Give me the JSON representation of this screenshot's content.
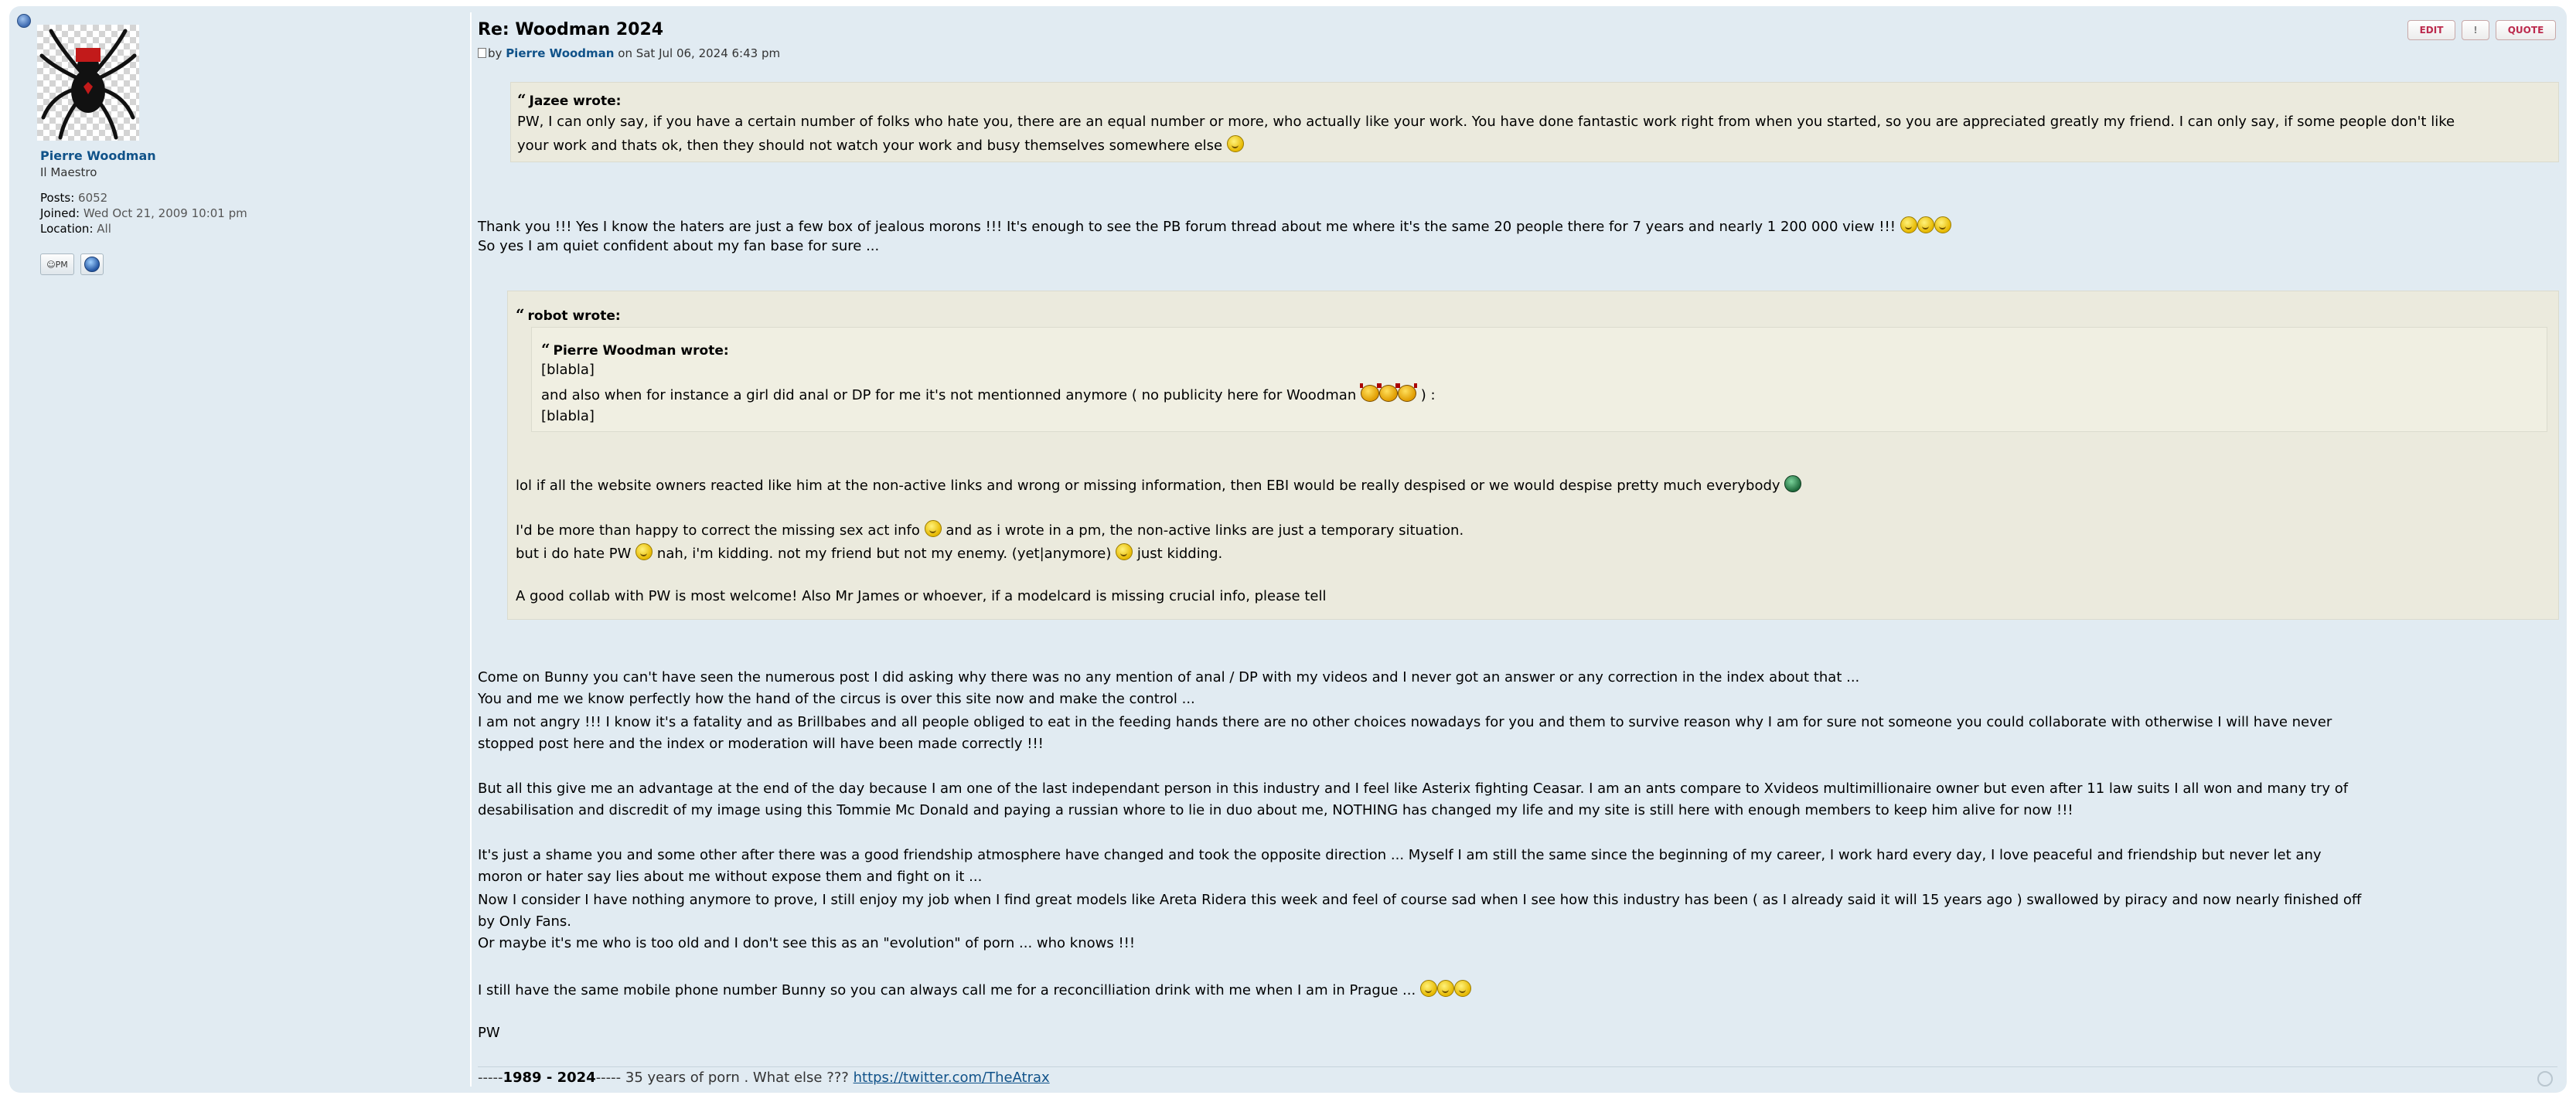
{
  "profile": {
    "username": "Pierre Woodman",
    "rank": "Il Maestro",
    "posts_label": "Posts:",
    "posts_value": "6052",
    "joined_label": "Joined:",
    "joined_value": "Wed Oct 21, 2009 10:01 pm",
    "location_label": "Location:",
    "location_value": "All",
    "pm_label": "PM"
  },
  "post": {
    "title": "Re: Woodman 2024",
    "by_prefix": "by",
    "author": "Pierre Woodman",
    "date_text": "on Sat Jul 06, 2024 6:43 pm",
    "buttons": {
      "edit": "EDIT",
      "warn": "!",
      "quote": "QUOTE"
    }
  },
  "quote1": {
    "cite": "Jazee wrote:",
    "line1": "PW, I can only say, if you have a certain number of folks who hate you, there are an equal number or more, who actually like your work. You have done fantastic work right from when you started, so you are appreciated greatly my friend. I can only say, if some people don't like",
    "line2": "your work and thats ok, then they should not watch your work and busy themselves somewhere else"
  },
  "reply1": {
    "line1": "Thank you !!! Yes I know the haters are just a few box of jealous morons !!! It's enough to see the PB forum thread about me where it's the same 20 people there for 7 years and nearly 1 200 000 view !!!",
    "line2": "So yes I am quiet confident about my fan base for sure ..."
  },
  "quote2": {
    "cite": "robot wrote:",
    "inner_cite": "Pierre Woodman wrote:",
    "inner_line1": "[blabla]",
    "inner_line2": "and also when for instance a girl did anal or DP for me it's not mentionned anymore ( no publicity here for Woodman",
    "inner_line2_end": ") :",
    "inner_line3": "[blabla]",
    "line1": "lol if all the website owners reacted like him at the non-active links and wrong or missing information, then EBI would be really despised or we would despise pretty much everybody",
    "line2": "I'd be more than happy to correct the missing sex act info",
    "line2_end": "and as i wrote in a pm, the non-active links are just a temporary situation.",
    "line3a": "but i do hate PW",
    "line3b": "nah, i'm kidding. not my friend but not my enemy. (yet|anymore)",
    "line3c": "just kidding.",
    "line4": "A good collab with PW is most welcome! Also Mr James or whoever, if a modelcard is missing crucial info, please tell"
  },
  "reply2": {
    "l1": "Come on Bunny you can't have seen the numerous post I did asking why there was no any mention of anal / DP with my videos and I never got an answer or any correction in the index about that ...",
    "l2": "You and me we know perfectly how the hand of the circus is over this site now and make the control ...",
    "l3": "I am not angry !!! I know it's a fatality and as Brillbabes and all people obliged to eat in the feeding hands there are no other choices nowadays for you and them to survive reason why I am for sure not someone you could collaborate with otherwise I will have never",
    "l4": "stopped post here and the index or moderation will have been made correctly !!!",
    "l5": "But all this give me an advantage at the end of the day because I am one of the last independant person in this industry and I feel like Asterix fighting Ceasar. I am an ants compare to Xvideos multimillionaire owner but even after 11 law suits I all won and many try of",
    "l6": "desabilisation and discredit of my image using this Tommie Mc Donald and paying a russian whore to lie in duo about me, NOTHING has changed my life and my site is still here with enough members to keep him alive for now !!!",
    "l7": "It's just a shame you and some other after there was a good friendship atmosphere have changed and took the opposite direction ... Myself I am still the same since the beginning of my career, I work hard every day, I love peaceful and friendship but never let any",
    "l8": "moron or hater say lies about me without expose them and fight on it ...",
    "l9": "Now I consider I have nothing anymore to prove, I still enjoy my job when I find great models like Areta Ridera this week and feel of course sad when I see how this industry has been ( as I already said it will 15 years ago ) swallowed by piracy and now nearly finished off",
    "l10": "by Only Fans.",
    "l11": "Or maybe it's me who is too old and I don't see this as an \"evolution\" of porn ... who knows !!!",
    "l12": "I still have the same mobile phone number Bunny so you can always call me for a reconcilliation drink with me when I am in Prague ...",
    "l13": "PW"
  },
  "signature": {
    "prefix": "-----",
    "years": "1989 - 2024",
    "suffix": "----- 35 years of porn . What else ???",
    "link": "https://twitter.com/TheAtrax"
  },
  "colors": {
    "post_bg": "#e1ebf2",
    "quote_bg": "#ebeadd",
    "link": "#105289",
    "button_text": "#bc2a4d"
  }
}
